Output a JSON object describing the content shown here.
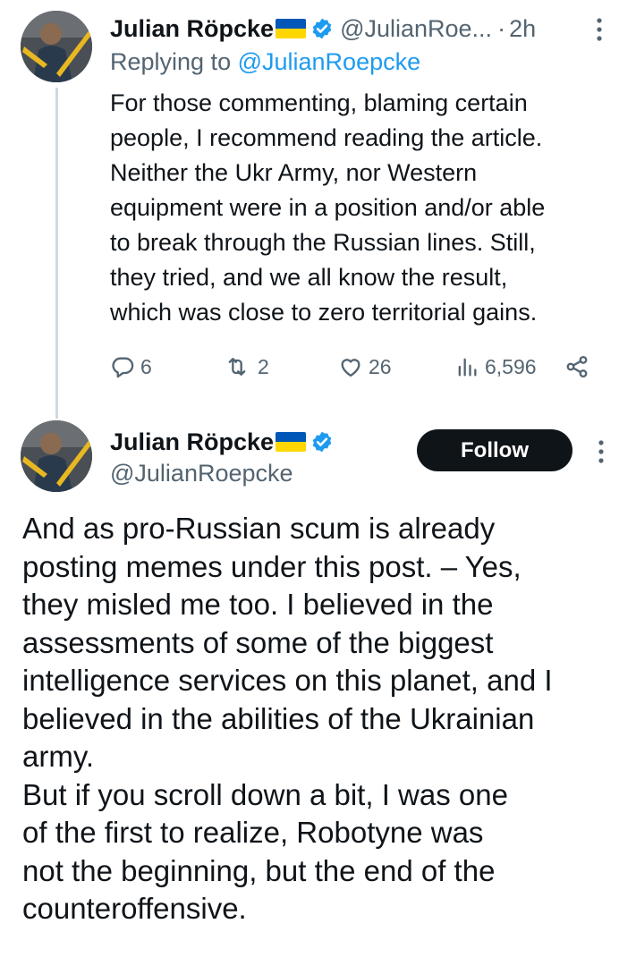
{
  "colors": {
    "text": "#0f1419",
    "secondary": "#536471",
    "link": "#1d9bf0",
    "verified": "#1d9bf0",
    "follow_bg": "#0f1419",
    "thread_line": "#cfd9de"
  },
  "reply_tweet": {
    "author_name": "Julian Röpcke",
    "handle": "@JulianRoe...",
    "dot": "·",
    "time": "2h",
    "replying_prefix": "Replying to ",
    "replying_handle": "@JulianRoepcke",
    "body_lines": [
      "For those commenting, blaming certain",
      "people, I recommend reading the article.",
      "Neither the Ukr Army, nor Western",
      "equipment were in a position and/or able",
      "to break through the Russian lines. Still,",
      "they tried, and we all know the result,",
      "which was close to zero territorial gains."
    ],
    "actions": {
      "replies": "6",
      "reposts": "2",
      "likes": "26",
      "views": "6,596"
    },
    "icons": [
      "reply-icon",
      "repost-icon",
      "like-icon",
      "views-icon",
      "share-icon"
    ]
  },
  "main_tweet": {
    "author_name": "Julian Röpcke",
    "handle": "@JulianRoepcke",
    "follow_label": "Follow",
    "body_lines": [
      "And as pro-Russian scum is already",
      "posting memes under this post. – Yes,",
      "they misled me too. I believed in the",
      "assessments of some of the biggest",
      "intelligence services on this planet, and I",
      "believed in the abilities of the Ukrainian",
      "army.",
      "But if you scroll down a bit, I was one",
      "of the first to realize, Robotyne was",
      "not the beginning, but the end of the",
      "counteroffensive."
    ]
  }
}
